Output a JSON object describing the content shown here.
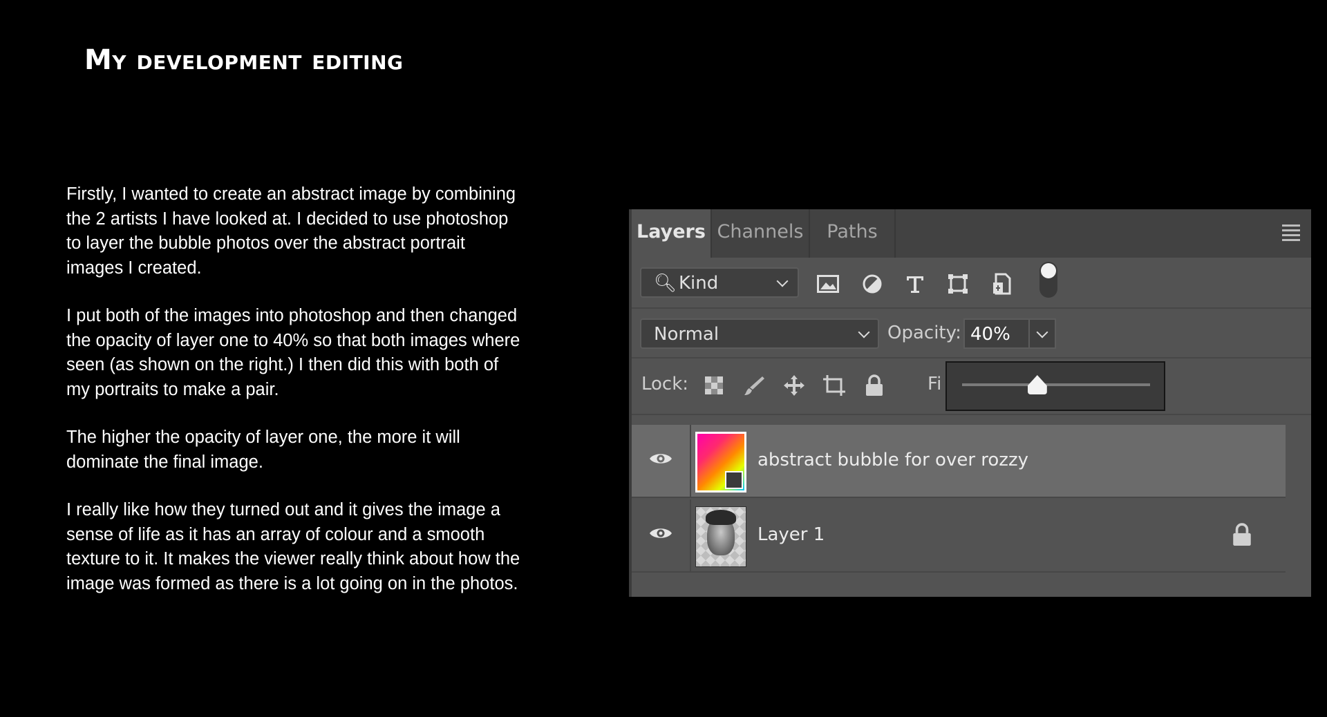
{
  "slide": {
    "title": "My development editing",
    "paragraphs": [
      "Firstly, I wanted to create an abstract image by combining the 2 artists I have looked at. I decided to use photoshop to layer the bubble photos over the abstract  portrait images I created.",
      "I put both of the images into photoshop and then changed the opacity of layer one to 40% so that both images where seen (as shown on the right.) I then did this with both of my portraits to make a pair.",
      "The higher the opacity of layer one, the more it will dominate the final image.",
      "I really like how they turned out and it gives the image a sense of life as it has an array of colour and a smooth texture to it. It makes the viewer really think about how the image was formed as there is a lot going on in the photos."
    ]
  },
  "layers_panel": {
    "tabs": [
      {
        "label": "Layers",
        "active": true
      },
      {
        "label": "Channels",
        "active": false
      },
      {
        "label": "Paths",
        "active": false
      }
    ],
    "menu_icon": "hamburger-menu-icon",
    "filter": {
      "kind_label": "Kind",
      "icons": [
        "image-filter-icon",
        "adjustment-filter-icon",
        "type-filter-icon",
        "shape-filter-icon",
        "smart-object-filter-icon"
      ]
    },
    "blend_mode": "Normal",
    "opacity_label": "Opacity:",
    "opacity_value": "40%",
    "opacity_fraction": 0.4,
    "lock_label": "Lock:",
    "fill_label": "Fi",
    "layers": [
      {
        "name": "abstract bubble for over rozzy",
        "selected": true,
        "visible": true,
        "locked": false
      },
      {
        "name": "Layer 1",
        "selected": false,
        "visible": true,
        "locked": true
      }
    ],
    "colors": {
      "panel_bg": "#535353",
      "tab_bar_bg": "#424242",
      "selected_layer_bg": "#6b6b6b"
    }
  }
}
